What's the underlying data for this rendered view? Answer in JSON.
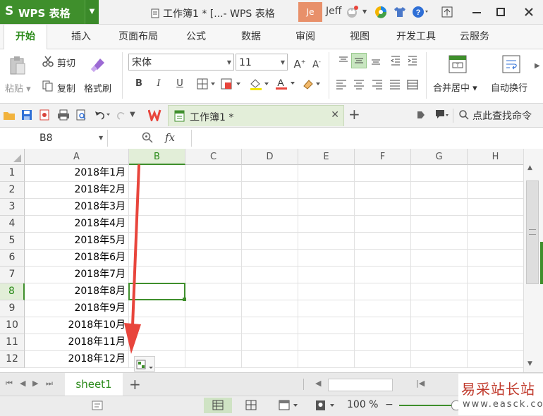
{
  "app": {
    "name": "WPS 表格",
    "logo_glyph": "S",
    "window_title": "工作簿1 * [...- WPS 表格",
    "user_avatar": "Je",
    "user_name": "Jeff"
  },
  "menu_tabs": [
    {
      "label": "开始",
      "active": true
    },
    {
      "label": "插入"
    },
    {
      "label": "页面布局"
    },
    {
      "label": "公式"
    },
    {
      "label": "数据"
    },
    {
      "label": "审阅"
    },
    {
      "label": "视图"
    },
    {
      "label": "开发工具"
    },
    {
      "label": "云服务"
    }
  ],
  "ribbon": {
    "paste_label": "粘贴",
    "cut_label": "剪切",
    "copy_label": "复制",
    "format_painter_label": "格式刷",
    "font_name": "宋体",
    "font_size": "11",
    "bold": "B",
    "italic": "I",
    "underline": "U",
    "font_grow": "A",
    "font_shrink": "A",
    "merge_center_label": "合并居中",
    "wrap_text_label": "自动换行"
  },
  "quick_access": {
    "doc_tab_title": "工作簿1 *",
    "search_commands_label": "点此查找命令"
  },
  "formula_bar": {
    "name_box": "B8",
    "fx_label": "fx",
    "formula": ""
  },
  "grid": {
    "columns": [
      "A",
      "B",
      "C",
      "D",
      "E",
      "F",
      "G",
      "H"
    ],
    "selected_column": "B",
    "selected_row": 8,
    "rows": [
      {
        "num": "1",
        "a": "2018年1月"
      },
      {
        "num": "2",
        "a": "2018年2月"
      },
      {
        "num": "3",
        "a": "2018年3月"
      },
      {
        "num": "4",
        "a": "2018年4月"
      },
      {
        "num": "5",
        "a": "2018年5月"
      },
      {
        "num": "6",
        "a": "2018年6月"
      },
      {
        "num": "7",
        "a": "2018年7月"
      },
      {
        "num": "8",
        "a": "2018年8月"
      },
      {
        "num": "9",
        "a": "2018年9月"
      },
      {
        "num": "10",
        "a": "2018年10月"
      },
      {
        "num": "11",
        "a": "2018年11月"
      },
      {
        "num": "12",
        "a": "2018年12月"
      }
    ]
  },
  "sheets": [
    {
      "name": "sheet1",
      "active": true
    }
  ],
  "status": {
    "zoom": "100 %"
  },
  "watermark": {
    "line1": "易采站长站",
    "line2": "www.easck.com"
  },
  "colors": {
    "brand_green": "#3f8f2c",
    "accent_red": "#e8453c"
  }
}
